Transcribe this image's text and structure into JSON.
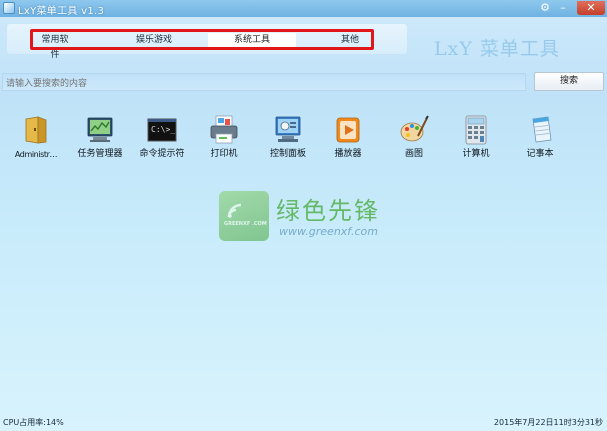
{
  "window": {
    "title": "LxY菜单工具 v1.3"
  },
  "titlebar_icons": {
    "settings": "gear-icon",
    "minimize": "minimize-icon",
    "close": "close-icon"
  },
  "tabs": [
    {
      "label": "常用软件",
      "active": false
    },
    {
      "label": "娱乐游戏",
      "active": false
    },
    {
      "label": "系统工具",
      "active": true
    },
    {
      "label": "其他",
      "active": false
    }
  ],
  "logo_text": "LxY 菜单工具",
  "search": {
    "placeholder": "请输入要搜索的内容",
    "button_label": "搜索"
  },
  "apps": [
    {
      "label": "Administr…",
      "icon": "folder-icon"
    },
    {
      "label": "任务管理器",
      "icon": "task-manager-icon"
    },
    {
      "label": "命令提示符",
      "icon": "command-prompt-icon"
    },
    {
      "label": "打印机",
      "icon": "printer-icon"
    },
    {
      "label": "控制面板",
      "icon": "control-panel-icon"
    },
    {
      "label": "播放器",
      "icon": "media-player-icon"
    },
    {
      "label": "画图",
      "icon": "paint-icon"
    },
    {
      "label": "计算机",
      "icon": "calculator-icon"
    },
    {
      "label": "记事本",
      "icon": "notepad-icon"
    }
  ],
  "watermark": {
    "brand": "绿色先锋",
    "url": "www.greenxf.com",
    "badge_text": "GREENXF .COM"
  },
  "status": {
    "cpu": "CPU占用率:14%",
    "datetime": "2015年7月22日11时3分31秒"
  },
  "colors": {
    "accent_red": "#e0161b",
    "title_bar": "#6fb2e2",
    "background": "#c9ecfb"
  }
}
